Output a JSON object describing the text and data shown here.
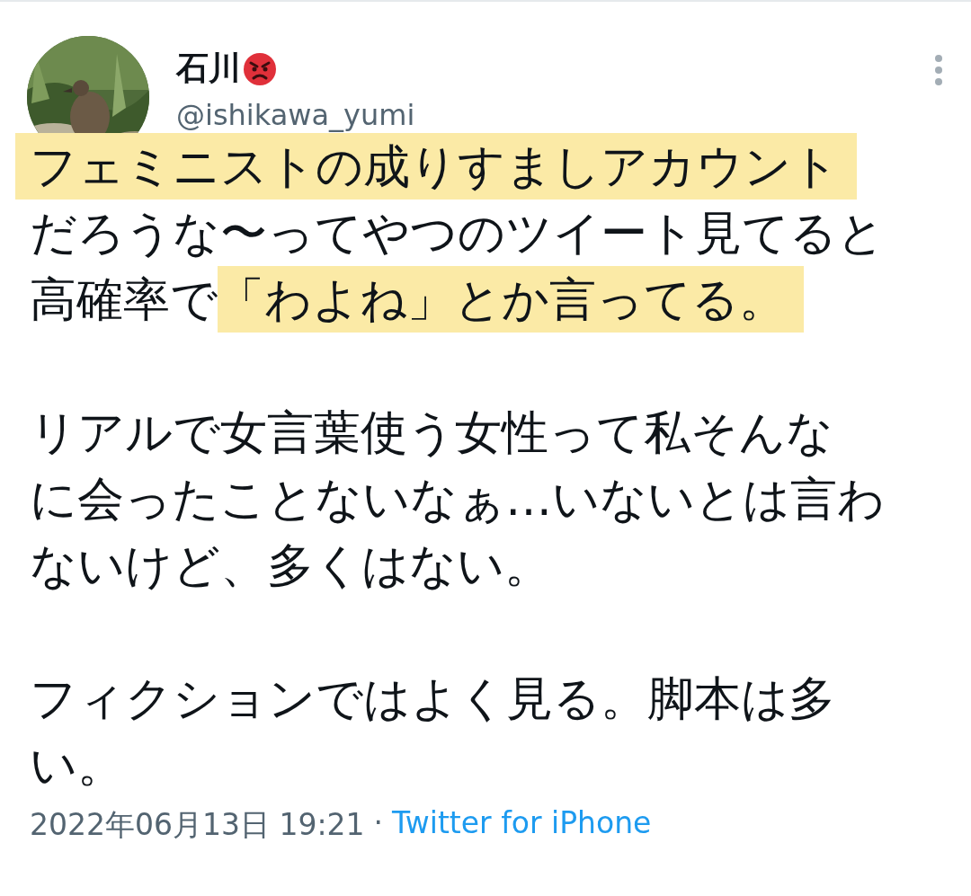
{
  "author": {
    "name": "石川",
    "handle": "@ishikawa_yumi"
  },
  "paragraphs": [
    {
      "lines": [
        [
          {
            "text": "フェミニストの成りすましアカウント",
            "highlighted": true
          }
        ],
        [
          {
            "text": "だろうな〜ってやつのツイート見てると",
            "highlighted": false
          }
        ],
        [
          {
            "text": "高確率で",
            "highlighted": false
          },
          {
            "text": "「わよね」とか言ってる。",
            "highlighted": true
          }
        ]
      ]
    },
    {
      "lines": [
        [
          {
            "text": "リアルで女言葉使う女性って私そんな",
            "highlighted": false
          }
        ],
        [
          {
            "text": "に会ったことないなぁ…いないとは言わ",
            "highlighted": false
          }
        ],
        [
          {
            "text": "ないけど、多くはない。",
            "highlighted": false
          }
        ]
      ]
    },
    {
      "lines": [
        [
          {
            "text": "フィクションではよく見る。脚本は多",
            "highlighted": false
          }
        ],
        [
          {
            "text": "い。",
            "highlighted": false
          }
        ]
      ]
    }
  ],
  "footer": {
    "timestamp": "2022年06月13日 19:21",
    "separator": "·",
    "source": "Twitter for iPhone"
  }
}
